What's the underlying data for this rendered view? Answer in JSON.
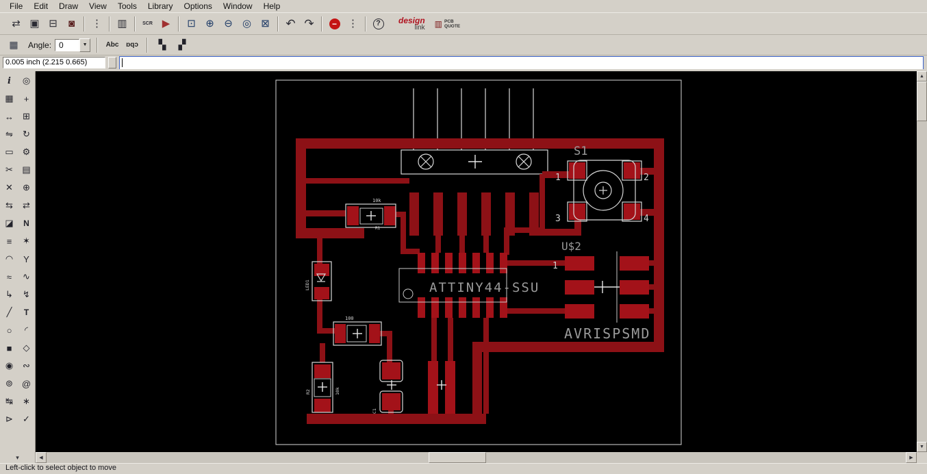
{
  "colors": {
    "chrome_bg": "#d4d0c8",
    "canvas_bg": "#000000",
    "copper": "#8d1116",
    "pad": "#a31219",
    "silk": "#d8d8d8",
    "label_gray": "#9a9a9a",
    "focus_blue": "#3a62c8"
  },
  "menu": {
    "items": [
      {
        "name": "menu-file",
        "label": "File"
      },
      {
        "name": "menu-edit",
        "label": "Edit"
      },
      {
        "name": "menu-draw",
        "label": "Draw"
      },
      {
        "name": "menu-view",
        "label": "View"
      },
      {
        "name": "menu-tools",
        "label": "Tools"
      },
      {
        "name": "menu-library",
        "label": "Library"
      },
      {
        "name": "menu-options",
        "label": "Options"
      },
      {
        "name": "menu-window",
        "label": "Window"
      },
      {
        "name": "menu-help",
        "label": "Help"
      }
    ]
  },
  "toolbar": {
    "buttons": [
      {
        "name": "switch-board-schematic-button",
        "icon": "board-schematic-icon",
        "glyph": "⇄"
      },
      {
        "name": "save-button",
        "icon": "save-icon",
        "glyph": "▣"
      },
      {
        "name": "print-button",
        "icon": "print-icon",
        "glyph": "⊟"
      },
      {
        "name": "cam-button",
        "icon": "cam-processor-icon",
        "glyph": "◙"
      },
      {
        "sep": true
      },
      {
        "name": "ulp-button",
        "icon": "ulp-icon",
        "glyph": "⋮"
      },
      {
        "sep": true
      },
      {
        "name": "layer-settings-button",
        "icon": "layers-icon",
        "glyph": "▥"
      },
      {
        "sep": true
      },
      {
        "name": "script-button",
        "icon": "script-icon",
        "glyph": "SCR"
      },
      {
        "name": "run-button",
        "icon": "run-icon",
        "glyph": "▶"
      },
      {
        "sep": true
      },
      {
        "name": "zoom-fit-button",
        "icon": "zoom-fit-icon",
        "glyph": "⊡"
      },
      {
        "name": "zoom-in-button",
        "icon": "zoom-in-icon",
        "glyph": "⊕"
      },
      {
        "name": "zoom-out-button",
        "icon": "zoom-out-icon",
        "glyph": "⊖"
      },
      {
        "name": "zoom-redraw-button",
        "icon": "zoom-redraw-icon",
        "glyph": "◎"
      },
      {
        "name": "zoom-select-button",
        "icon": "zoom-select-icon",
        "glyph": "⊠"
      },
      {
        "sep": true
      },
      {
        "name": "undo-button",
        "icon": "undo-icon",
        "glyph": "↶"
      },
      {
        "name": "redo-button",
        "icon": "redo-icon",
        "glyph": "↷"
      },
      {
        "sep": true
      },
      {
        "name": "stop-button",
        "icon": "stop-icon",
        "glyph": "−"
      },
      {
        "name": "go-button",
        "icon": "go-icon",
        "glyph": "⋮"
      },
      {
        "sep": true
      },
      {
        "name": "help-button",
        "icon": "help-icon",
        "glyph": "?"
      }
    ],
    "design_link": {
      "line1": "design",
      "line2": "link"
    },
    "pcb_quote": {
      "line1": "PCB",
      "line2": "QUOTE"
    }
  },
  "param_bar": {
    "grid_glyph": "▦",
    "angle_label": "Angle:",
    "angle_value": "0",
    "dropdown_glyph": "▼",
    "abc_label": "Abc",
    "abc_mirrored_label": "ɒqɔ",
    "tile1_glyph": "▚",
    "tile2_glyph": "▞"
  },
  "command_bar": {
    "coordinates": "0.005 inch (2.215 0.665)",
    "command_value": ""
  },
  "sidebar": {
    "tools": [
      {
        "name": "info-tool",
        "icon": "info-icon",
        "glyph": "i"
      },
      {
        "name": "show-tool",
        "icon": "show-icon",
        "glyph": "◎"
      },
      {
        "name": "display-tool",
        "icon": "display-icon",
        "glyph": "▦"
      },
      {
        "name": "mark-tool",
        "icon": "mark-icon",
        "glyph": "+"
      },
      {
        "name": "move-tool",
        "icon": "move-icon",
        "glyph": "↔"
      },
      {
        "name": "copy-tool",
        "icon": "copy-icon",
        "glyph": "⊞"
      },
      {
        "name": "mirror-tool",
        "icon": "mirror-icon",
        "glyph": "⇋"
      },
      {
        "name": "rotate-tool",
        "icon": "rotate-icon",
        "glyph": "↻"
      },
      {
        "name": "group-tool",
        "icon": "group-icon",
        "glyph": "▭"
      },
      {
        "name": "change-tool",
        "icon": "change-icon",
        "glyph": "⚙"
      },
      {
        "name": "cut-tool",
        "icon": "cut-icon",
        "glyph": "✂"
      },
      {
        "name": "paste-tool",
        "icon": "paste-icon",
        "glyph": "▤"
      },
      {
        "name": "delete-tool",
        "icon": "delete-icon",
        "glyph": "✕"
      },
      {
        "name": "add-tool",
        "icon": "add-icon",
        "glyph": "⊕"
      },
      {
        "name": "pinswap-tool",
        "icon": "pinswap-icon",
        "glyph": "⇆"
      },
      {
        "name": "replace-tool",
        "icon": "replace-icon",
        "glyph": "⇄"
      },
      {
        "name": "lock-tool",
        "icon": "lock-icon",
        "glyph": "◪"
      },
      {
        "name": "name-tool",
        "icon": "name-icon",
        "glyph": "N"
      },
      {
        "name": "value-tool",
        "icon": "value-icon",
        "glyph": "≡"
      },
      {
        "name": "smash-tool",
        "icon": "smash-icon",
        "glyph": "✶"
      },
      {
        "name": "miter-tool",
        "icon": "miter-icon",
        "glyph": "◠"
      },
      {
        "name": "split-tool",
        "icon": "split-icon",
        "glyph": "Y"
      },
      {
        "name": "meander-tool",
        "icon": "meander-icon",
        "glyph": "≈"
      },
      {
        "name": "optimize-tool",
        "icon": "optimize-icon",
        "glyph": "∿"
      },
      {
        "name": "route-tool",
        "icon": "route-icon",
        "glyph": "↳"
      },
      {
        "name": "ripup-tool",
        "icon": "ripup-icon",
        "glyph": "↯"
      },
      {
        "name": "wire-tool",
        "icon": "wire-icon",
        "glyph": "╱"
      },
      {
        "name": "text-tool",
        "icon": "text-icon",
        "glyph": "T"
      },
      {
        "name": "circle-tool",
        "icon": "circle-icon",
        "glyph": "○"
      },
      {
        "name": "arc-tool",
        "icon": "arc-icon",
        "glyph": "◜"
      },
      {
        "name": "rect-tool",
        "icon": "rect-icon",
        "glyph": "■"
      },
      {
        "name": "polygon-tool",
        "icon": "polygon-icon",
        "glyph": "◇"
      },
      {
        "name": "via-tool",
        "icon": "via-icon",
        "glyph": "◉"
      },
      {
        "name": "signal-tool",
        "icon": "signal-icon",
        "glyph": "∾"
      },
      {
        "name": "hole-tool",
        "icon": "hole-icon",
        "glyph": "⊚"
      },
      {
        "name": "attribute-tool",
        "icon": "attribute-icon",
        "glyph": "@"
      },
      {
        "name": "dimension-tool",
        "icon": "dimension-icon",
        "glyph": "↹"
      },
      {
        "name": "ratsnest-tool",
        "icon": "ratsnest-icon",
        "glyph": "∗"
      },
      {
        "name": "auto-tool",
        "icon": "auto-icon",
        "glyph": "⊳"
      },
      {
        "name": "drc-tool",
        "icon": "drc-icon",
        "glyph": "✓"
      }
    ],
    "scroll_down_glyph": "▾"
  },
  "scrollbars": {
    "up_glyph": "▲",
    "down_glyph": "▼",
    "left_glyph": "◀",
    "right_glyph": "▶"
  },
  "board": {
    "components": {
      "s1": {
        "ref": "S1",
        "pins": [
          "1",
          "2",
          "3",
          "4"
        ]
      },
      "u2": {
        "ref": "U$2",
        "pin1": "1"
      },
      "ic1": {
        "value": "ATTINY44-SSU"
      },
      "module_name": "AVRISPSMD",
      "r1": {
        "ref": "R1",
        "value": "10k"
      },
      "r3": {
        "value": "100"
      },
      "led1": {
        "ref": "LED1"
      },
      "r2": {
        "ref": "R2",
        "value": "10k"
      },
      "c1": {
        "ref": "C1"
      }
    }
  },
  "status_bar": {
    "text": "Left-click to select object to move"
  }
}
